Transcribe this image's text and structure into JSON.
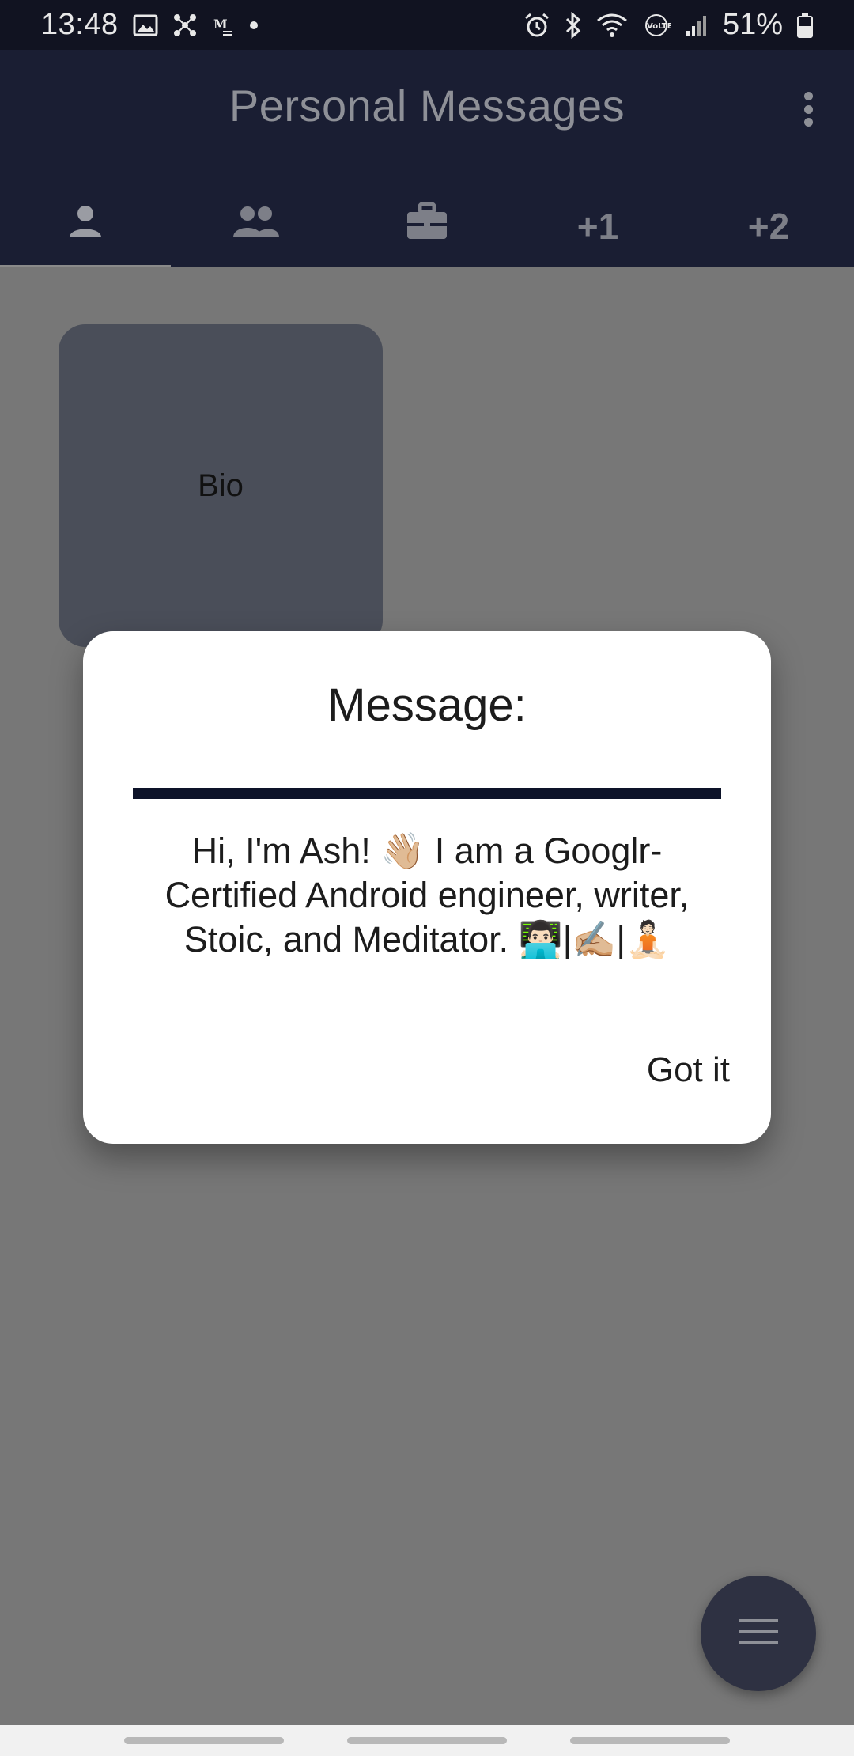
{
  "status_bar": {
    "time": "13:48",
    "battery": "51%",
    "left_icons": [
      "image-icon",
      "network-hub-icon",
      "medium-icon",
      "dot-icon"
    ],
    "right_icons": [
      "alarm-icon",
      "bluetooth-icon",
      "wifi-icon",
      "volte-icon",
      "signal-icon",
      "battery-icon"
    ]
  },
  "app_bar": {
    "title": "Personal Messages",
    "tabs": [
      {
        "icon": "person-icon",
        "label": ""
      },
      {
        "icon": "people-icon",
        "label": ""
      },
      {
        "icon": "briefcase-icon",
        "label": ""
      },
      {
        "icon": "",
        "label": "+1"
      },
      {
        "icon": "",
        "label": "+2"
      }
    ],
    "active_tab_index": 0
  },
  "content": {
    "card": {
      "label": "Bio"
    }
  },
  "dialog": {
    "title": "Message:",
    "message": "Hi, I'm Ash! 👋🏼 I am a Googlr-Certified Android engineer, writer, Stoic, and Meditator. 👨🏻‍💻|✍🏼|🧘🏻",
    "action_label": "Got it"
  },
  "fab": {
    "icon": "menu-icon"
  },
  "colors": {
    "status_bar_bg": "#111321",
    "app_bar_bg": "#1a1e33",
    "scrim": "#777777",
    "card_bg": "#4a4e59",
    "divider": "#0d1329",
    "fab_bg": "#2e3142"
  }
}
